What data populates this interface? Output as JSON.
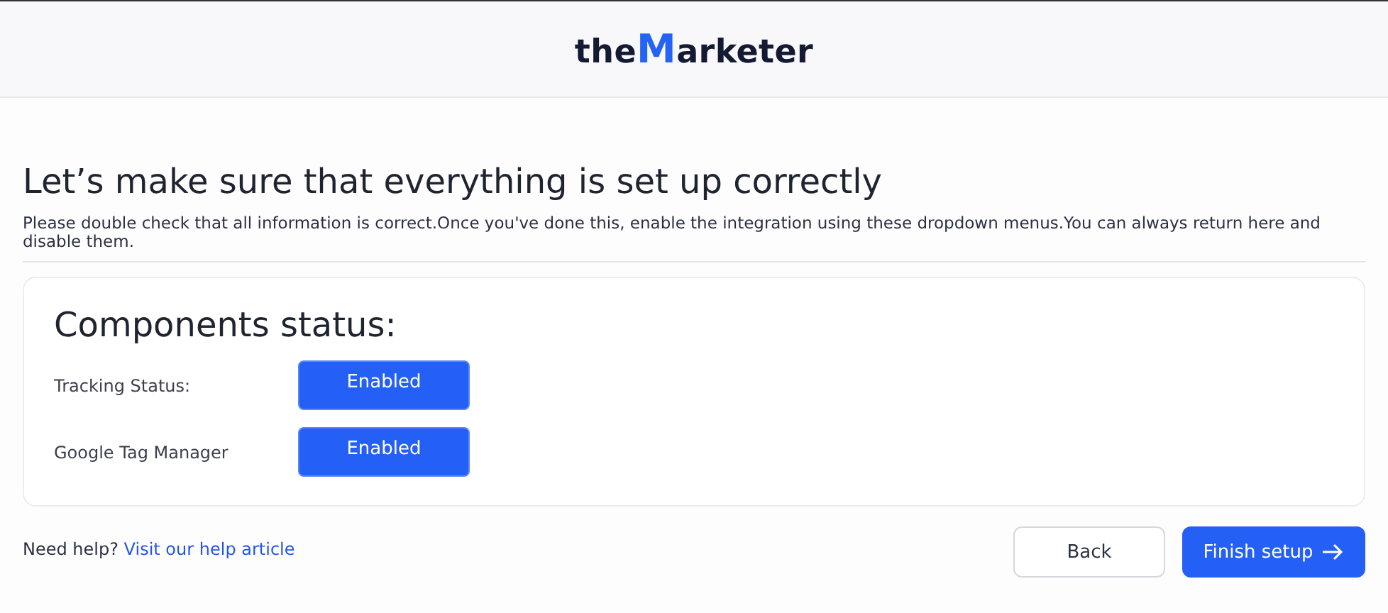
{
  "logo": {
    "prefix": "the",
    "mark": "M",
    "suffix": "arketer"
  },
  "heading": "Let’s make sure that everything is set up correctly",
  "description": "Please double check that all information is correct.Once you've done this, enable the integration using these dropdown menus.You can always return here and disable them.",
  "components": {
    "title": "Components status:",
    "rows": [
      {
        "label": "Tracking Status:",
        "value": "Enabled"
      },
      {
        "label": "Google Tag Manager",
        "value": "Enabled"
      }
    ]
  },
  "help": {
    "text": "Need help?",
    "link": "Visit our help article"
  },
  "buttons": [
    {
      "label": "Back",
      "kind": "secondary"
    },
    {
      "label": "Finish setup",
      "kind": "primary"
    }
  ]
}
